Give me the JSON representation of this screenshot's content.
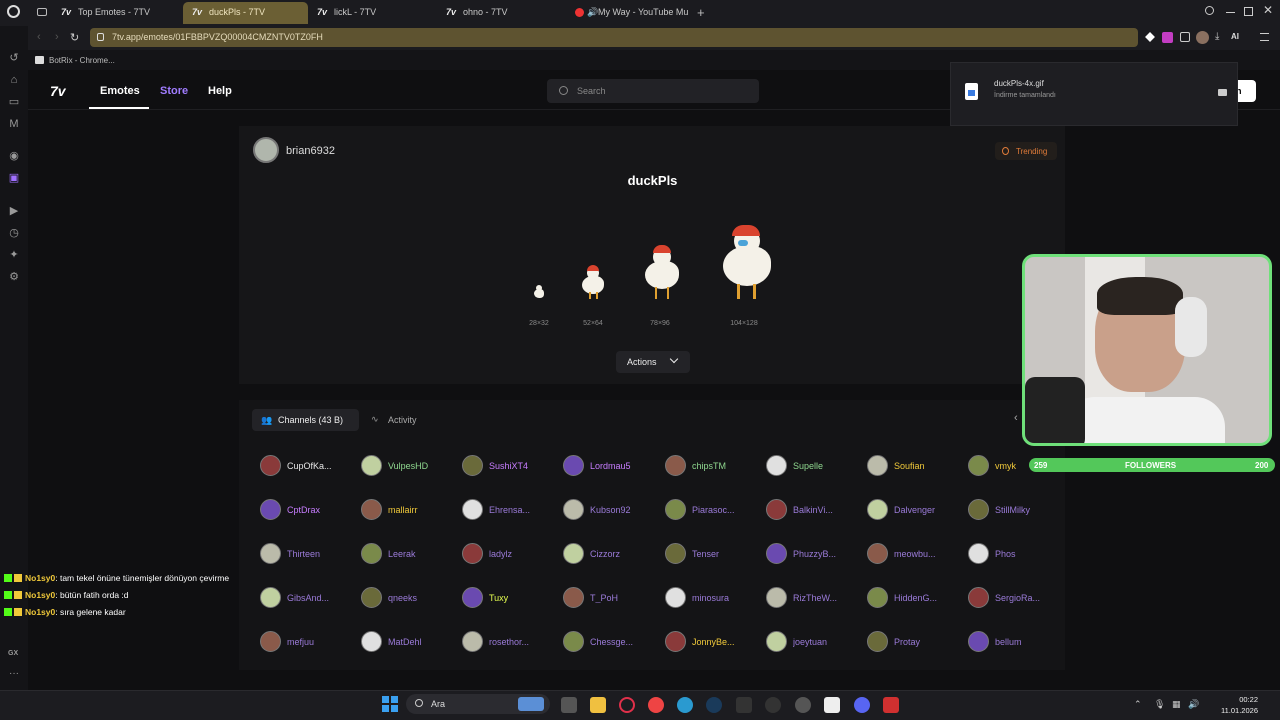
{
  "browser": {
    "tabs": [
      {
        "title": "Top Emotes - 7TV",
        "active": false
      },
      {
        "title": "duckPls - 7TV",
        "active": true
      },
      {
        "title": "lickL - 7TV",
        "active": false
      },
      {
        "title": "ohno - 7TV",
        "active": false
      },
      {
        "title": "My Way - YouTube Mu",
        "active": false
      }
    ],
    "url": "7tv.app/emotes/01FBBPVZQ00004CMZNTV0TZ0FH",
    "bookmark": "BotRix - Chrome...",
    "icon_names": [
      "opera-logo",
      "new-tab-icon",
      "reload-icon",
      "search-icon",
      "minimize-icon",
      "maximize-icon",
      "close-icon",
      "ai-icon"
    ],
    "ai_label": "AI"
  },
  "download": {
    "filename": "duckPls-4x.gif",
    "status": "İndirme tamamlandı"
  },
  "site": {
    "logo": "7v",
    "nav": [
      "Emotes",
      "Store",
      "Help"
    ],
    "search_placeholder": "Search",
    "signin_partial": "n"
  },
  "emote": {
    "owner": "brian6932",
    "name": "duckPls",
    "trending": "Trending",
    "sizes": [
      "28×32",
      "52×64",
      "78×96",
      "104×128"
    ],
    "actions_label": "Actions"
  },
  "channels": {
    "tab_channels": "Channels (43 B)",
    "tab_activity": "Activity",
    "rows": [
      [
        {
          "n": "CupOfKa...",
          "c": "#e6e6e6"
        },
        {
          "n": "VulpesHD",
          "c": "#8fd88f"
        },
        {
          "n": "SushiXT4",
          "c": "#c77dff"
        },
        {
          "n": "Lordmau5",
          "c": "#c77dff"
        },
        {
          "n": "chipsTM",
          "c": "#8fd88f"
        },
        {
          "n": "Supelle",
          "c": "#8fd88f"
        },
        {
          "n": "Soufian",
          "c": "#f0c93a"
        },
        {
          "n": "vmyk",
          "c": "#f0c93a"
        }
      ],
      [
        {
          "n": "CptDrax",
          "c": "#c77dff"
        },
        {
          "n": "mallairr",
          "c": "#f0c93a"
        },
        {
          "n": "Ehrensa...",
          "c": "#9b7bd9"
        },
        {
          "n": "Kubson92",
          "c": "#9b7bd9"
        },
        {
          "n": "Piarasoc...",
          "c": "#9b7bd9"
        },
        {
          "n": "BalkinVi...",
          "c": "#9b7bd9"
        },
        {
          "n": "Dalvenger",
          "c": "#9b7bd9"
        },
        {
          "n": "StillMilky",
          "c": "#9b7bd9"
        }
      ],
      [
        {
          "n": "Thirteen",
          "c": "#9b7bd9"
        },
        {
          "n": "Leerak",
          "c": "#9b7bd9"
        },
        {
          "n": "ladylz",
          "c": "#9b7bd9"
        },
        {
          "n": "Cizzorz",
          "c": "#9b7bd9"
        },
        {
          "n": "Tenser",
          "c": "#9b7bd9"
        },
        {
          "n": "PhuzzyB...",
          "c": "#9b7bd9"
        },
        {
          "n": "meowbu...",
          "c": "#9b7bd9"
        },
        {
          "n": "Phos",
          "c": "#9b7bd9"
        }
      ],
      [
        {
          "n": "GibsAnd...",
          "c": "#9b7bd9"
        },
        {
          "n": "qneeks",
          "c": "#9b7bd9"
        },
        {
          "n": "Tuxy",
          "c": "#e6ff50"
        },
        {
          "n": "T_PoH",
          "c": "#9b7bd9"
        },
        {
          "n": "minosura",
          "c": "#9b7bd9"
        },
        {
          "n": "RizTheW...",
          "c": "#9b7bd9"
        },
        {
          "n": "HiddenG...",
          "c": "#9b7bd9"
        },
        {
          "n": "SergioRa...",
          "c": "#9b7bd9"
        }
      ],
      [
        {
          "n": "mefjuu",
          "c": "#9b7bd9"
        },
        {
          "n": "MatDehl",
          "c": "#9b7bd9"
        },
        {
          "n": "rosethor...",
          "c": "#9b7bd9"
        },
        {
          "n": "Chessge...",
          "c": "#9b7bd9"
        },
        {
          "n": "JonnyBe...",
          "c": "#f0c93a"
        },
        {
          "n": "joeytuan",
          "c": "#9b7bd9"
        },
        {
          "n": "Protay",
          "c": "#9b7bd9"
        },
        {
          "n": "bellum",
          "c": "#9b7bd9"
        }
      ]
    ]
  },
  "overlay": {
    "followers_label": "FOLLOWERS",
    "followers_current": "259",
    "followers_goal": "200",
    "chat": [
      {
        "user": "No1sy0",
        "msg": ": tam tekel önüne tünemişler dönüyon çevirme"
      },
      {
        "user": "No1sy0",
        "msg": ": bütün fatih orda :d"
      },
      {
        "user": "No1sy0",
        "msg": ": sıra gelene kadar"
      }
    ],
    "watermark": "GX"
  },
  "taskbar": {
    "search": "Ara",
    "time": "00:22",
    "date": "11.01.2026"
  },
  "colors": {
    "accent": "#a07cff",
    "url_bar": "#5e5330",
    "cam_border": "#6fe07a"
  }
}
